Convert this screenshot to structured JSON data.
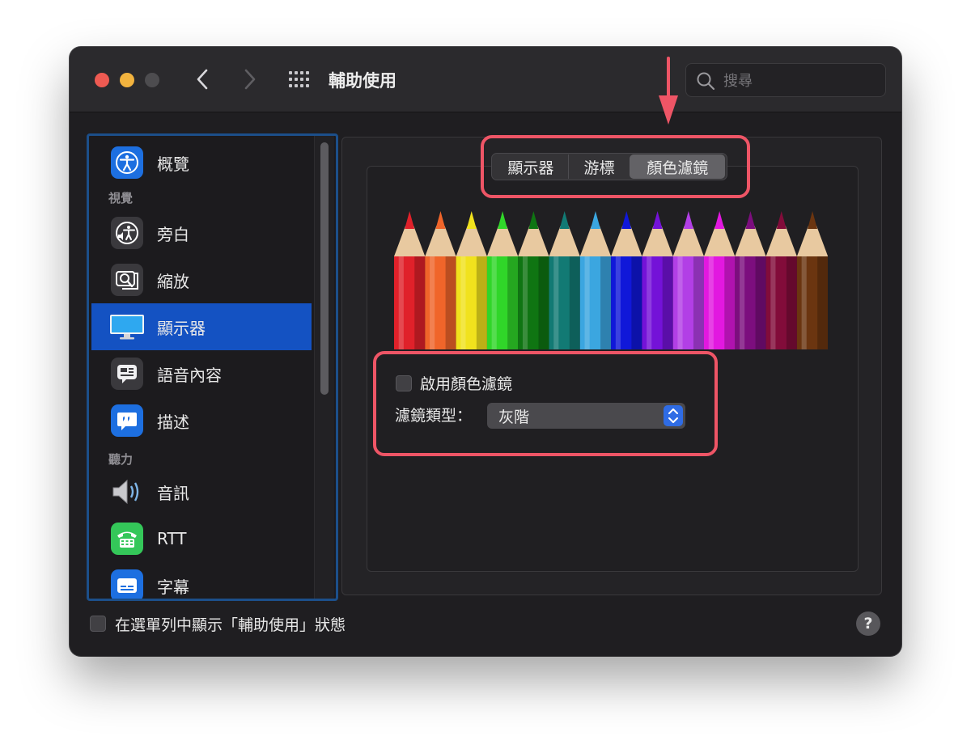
{
  "window": {
    "title": "輔助使用",
    "search_placeholder": "搜尋"
  },
  "sidebar": {
    "sections": [
      "視覺",
      "聽力"
    ],
    "items": [
      {
        "label": "概覽",
        "icon": "accessibility-icon"
      },
      {
        "label": "旁白",
        "icon": "voiceover-icon"
      },
      {
        "label": "縮放",
        "icon": "zoom-icon"
      },
      {
        "label": "顯示器",
        "icon": "display-icon",
        "selected": true
      },
      {
        "label": "語音內容",
        "icon": "spoken-content-icon"
      },
      {
        "label": "描述",
        "icon": "descriptions-icon"
      },
      {
        "label": "音訊",
        "icon": "speaker-icon"
      },
      {
        "label": "RTT",
        "icon": "rtt-phone-icon"
      },
      {
        "label": "字幕",
        "icon": "captions-icon"
      }
    ]
  },
  "tabs": [
    {
      "label": "顯示器",
      "selected": false
    },
    {
      "label": "游標",
      "selected": false
    },
    {
      "label": "顏色濾鏡",
      "selected": true
    }
  ],
  "color_filter": {
    "enable_label": "啟用顏色濾鏡",
    "enabled": false,
    "type_label": "濾鏡類型：",
    "type_value": "灰階"
  },
  "footer": {
    "menu_bar_label": "在選單列中顯示「輔助使用」狀態",
    "help_label": "?"
  },
  "pencil_colors": [
    "#e0212a",
    "#f0652a",
    "#f1e21d",
    "#30d629",
    "#0f7512",
    "#127a74",
    "#3ba6e0",
    "#1018d9",
    "#7412d8",
    "#b23fe6",
    "#e218e0",
    "#7c0e7e",
    "#820c3a",
    "#6b3510"
  ],
  "annotation_color": "#ee5566"
}
